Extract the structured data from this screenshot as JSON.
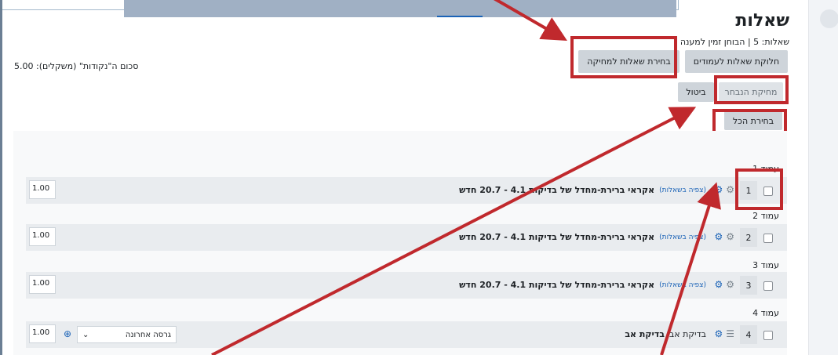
{
  "page": {
    "title": "שאלות",
    "info": "שאלות: 5 | הבוחן זמין למענה",
    "sum_marks": "סכום ה\"נקודות\" (משקלים): 5.00"
  },
  "toolbar": {
    "repaginate_label": "חלוקת שאלות לעמודים",
    "select_multiple_label": "בחירת שאלות למחיקה",
    "delete_selected_label": "מחיקת הנבחר",
    "cancel_label": "ביטול",
    "select_all_label": "בחירת הכל"
  },
  "icons": {
    "gear": "gear-icon",
    "random": "random-question-icon",
    "zoom": "magnifier-icon",
    "multichoice": "multichoice-icon"
  },
  "colors": {
    "annotation_red": "#c0292d",
    "link_blue": "#1b63b7"
  },
  "questions": [
    {
      "page_label": "עמוד 1",
      "number": "1",
      "title": "אקראי ברירת-מחדל של בדיקות 4.1 - 20.7 חדש",
      "link": "(צפיה בשאלות)",
      "mark": "1.00"
    },
    {
      "page_label": "עמוד 2",
      "number": "2",
      "title": "אקראי ברירת-מחדל של בדיקות 4.1 - 20.7 חדש",
      "link": "(צפיה בשאלות)",
      "mark": "1.00"
    },
    {
      "page_label": "עמוד 3",
      "number": "3",
      "title": "אקראי ברירת-מחדל של בדיקות 4.1 - 20.7 חדש",
      "link": "(צפיה בשאלות)",
      "mark": "1.00"
    },
    {
      "page_label": "עמוד 4",
      "number": "4",
      "title": "בדיקת אב",
      "subtitle": "בדיקת אב",
      "mark": "1.00",
      "version": "גרסה אחרונה"
    }
  ]
}
